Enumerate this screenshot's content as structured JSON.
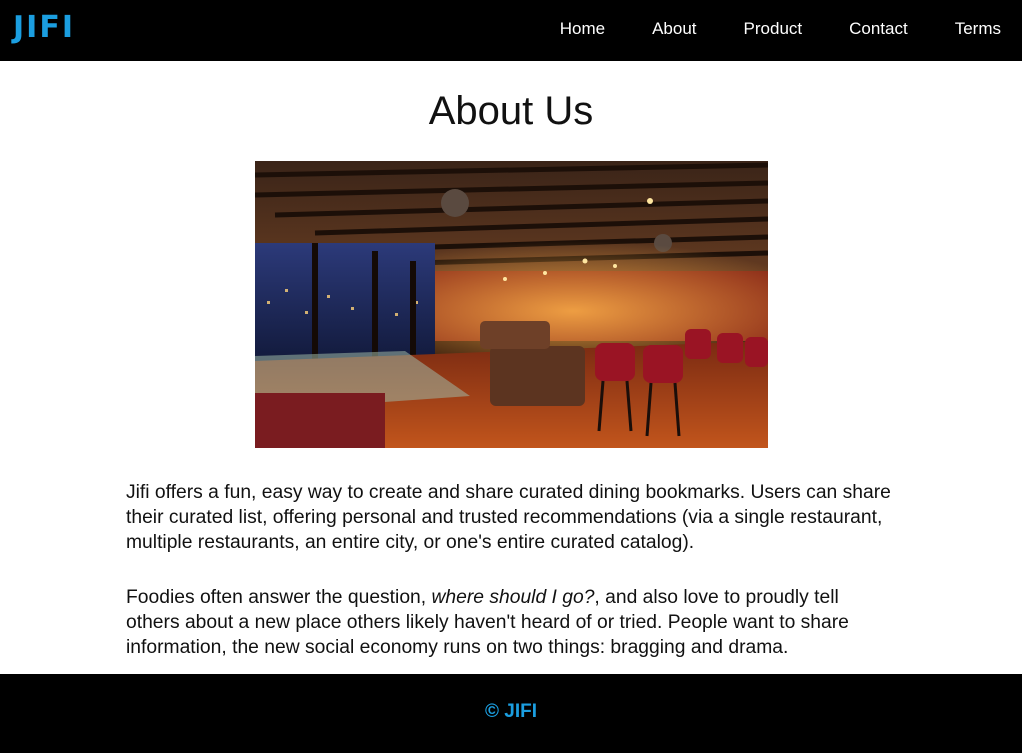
{
  "brand": {
    "logo_text": "JIFI",
    "accent_color": "#1b9ee0"
  },
  "nav": {
    "items": [
      {
        "label": "Home"
      },
      {
        "label": "About"
      },
      {
        "label": "Product"
      },
      {
        "label": "Contact"
      },
      {
        "label": "Terms"
      }
    ]
  },
  "main": {
    "title": "About Us",
    "paragraph_1": "Jifi offers a fun, easy way to create and share curated dining bookmarks. Users can share their curated list, offering personal and trusted recommendations (via a single restaurant, multiple restaurants, an entire city, or one's entire curated catalog).",
    "paragraph_2": {
      "before": "Foodies often answer the question, ",
      "emphasis": "where should I go?",
      "after": ", and also love to proudly tell others about a new place others likely haven't heard of or tried. People want to share information, the new social economy runs on two things: bragging and drama."
    }
  },
  "footer": {
    "copyright": "© JIFI"
  }
}
